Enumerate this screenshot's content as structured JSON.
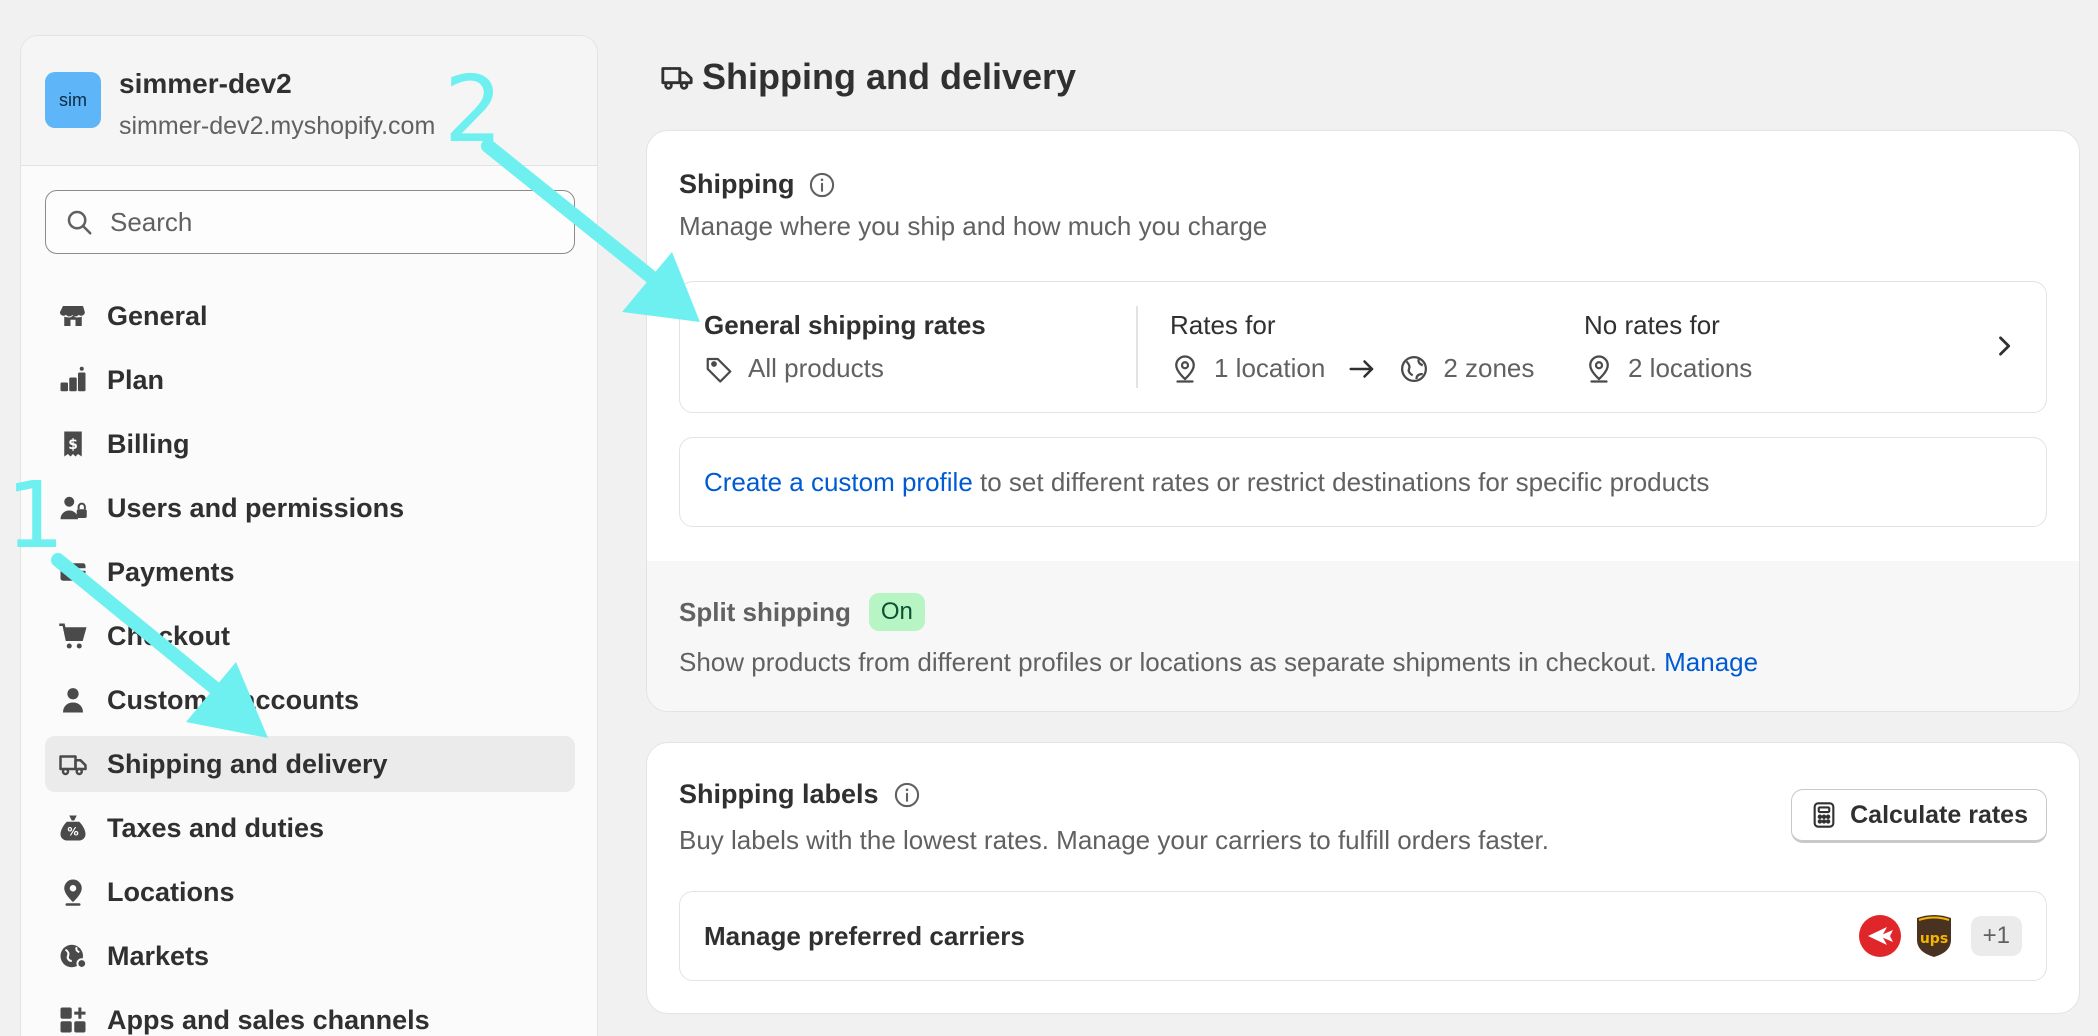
{
  "store": {
    "avatar": "sim",
    "name": "simmer-dev2",
    "domain": "simmer-dev2.myshopify.com"
  },
  "search": {
    "placeholder": "Search"
  },
  "sidebar": {
    "items": [
      {
        "label": "General",
        "icon": "store-icon"
      },
      {
        "label": "Plan",
        "icon": "plan-icon"
      },
      {
        "label": "Billing",
        "icon": "receipt-dollar-icon"
      },
      {
        "label": "Users and permissions",
        "icon": "users-icon"
      },
      {
        "label": "Payments",
        "icon": "credit-card-icon"
      },
      {
        "label": "Checkout",
        "icon": "cart-icon"
      },
      {
        "label": "Customer accounts",
        "icon": "person-icon"
      },
      {
        "label": "Shipping and delivery",
        "icon": "truck-icon",
        "active": true
      },
      {
        "label": "Taxes and duties",
        "icon": "tax-bag-icon"
      },
      {
        "label": "Locations",
        "icon": "location-pin-icon"
      },
      {
        "label": "Markets",
        "icon": "globe-icon"
      },
      {
        "label": "Apps and sales channels",
        "icon": "apps-icon"
      }
    ]
  },
  "page": {
    "title": "Shipping and delivery"
  },
  "shipping": {
    "title": "Shipping",
    "subtitle": "Manage where you ship and how much you charge",
    "general_rates": {
      "title": "General shipping rates",
      "products": "All products",
      "rates_for_label": "Rates for",
      "rates_for_location": "1 location",
      "rates_for_zones": "2 zones",
      "no_rates_label": "No rates for",
      "no_rates_locations": "2 locations"
    },
    "custom_profile": {
      "link": "Create a custom profile",
      "text": " to set different rates or restrict destinations for specific products"
    },
    "split": {
      "title": "Split shipping",
      "badge": "On",
      "description": "Show products from different profiles or locations as separate shipments in checkout. ",
      "manage_link": "Manage"
    }
  },
  "labels": {
    "title": "Shipping labels",
    "subtitle": "Buy labels with the lowest rates. Manage your carriers to fulfill orders faster.",
    "calculate_button": "Calculate rates",
    "carriers_label": "Manage preferred carriers",
    "more_carriers": "+1",
    "carrier_ups_text": "ups"
  },
  "annotations": {
    "marker_1": "1",
    "marker_2": "2",
    "color": "#6ff0f0"
  },
  "colors": {
    "link": "#005bd3",
    "badge_on_bg": "#b7f5c4",
    "avatar_bg": "#5eb5f7"
  }
}
